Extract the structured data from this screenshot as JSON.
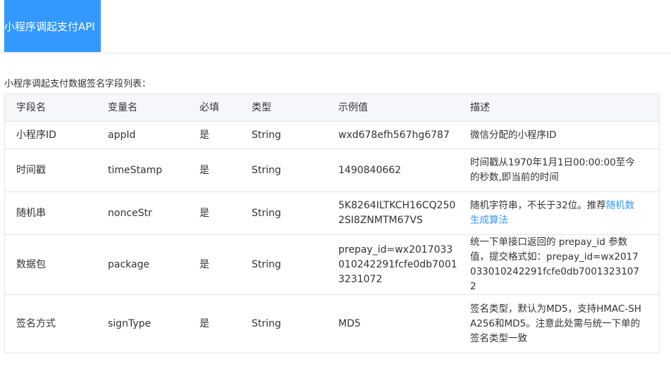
{
  "header": {
    "tab_label": "小程序调起支付API"
  },
  "caption": "小程序调起支付数据签名字段列表：",
  "table": {
    "columns": [
      "字段名",
      "变量名",
      "必填",
      "类型",
      "示例值",
      "描述"
    ],
    "rows": [
      {
        "field": "小程序ID",
        "var": "appId",
        "required": "是",
        "type": "String",
        "example": "wxd678efh567hg6787",
        "desc": "微信分配的小程序ID"
      },
      {
        "field": "时间戳",
        "var": "timeStamp",
        "required": "是",
        "type": "String",
        "example": "1490840662",
        "desc": "时间戳从1970年1月1日00:00:00至今的秒数,即当前的时间"
      },
      {
        "field": "随机串",
        "var": "nonceStr",
        "required": "是",
        "type": "String",
        "example": "5K8264ILTKCH16CQ2502SI8ZNMTM67VS",
        "desc_prefix": "随机字符串，不长于32位。推荐",
        "desc_link": "随机数生成算法"
      },
      {
        "field": "数据包",
        "var": "package",
        "required": "是",
        "type": "String",
        "example": "prepay_id=wx2017033010242291fcfe0db70013231072",
        "desc": "统一下单接口返回的 prepay_id 参数值，提交格式如：prepay_id=wx2017033010242291fcfe0db70013231072"
      },
      {
        "field": "签名方式",
        "var": "signType",
        "required": "是",
        "type": "String",
        "example": "MD5",
        "desc": "签名类型，默认为MD5，支持HMAC-SHA256和MD5。注意此处需与统一下单的签名类型一致"
      }
    ]
  },
  "colors": {
    "accent": "#3399ff",
    "header_bg": "#f5f7fa",
    "border": "#e5e5e5"
  }
}
